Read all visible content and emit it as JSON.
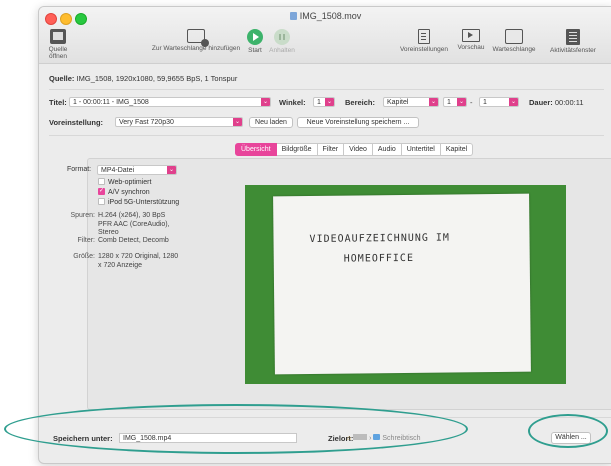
{
  "window": {
    "title": "IMG_1508.mov"
  },
  "toolbar": {
    "open_source": "Quelle öffnen",
    "add_queue": "Zur Warteschlange hinzufügen",
    "start": "Start",
    "pause": "Anhalten",
    "presets": "Voreinstellungen",
    "preview": "Vorschau",
    "queue": "Warteschlange",
    "activity": "Aktivitätsfenster"
  },
  "source": {
    "label": "Quelle:",
    "value": "IMG_1508, 1920x1080, 59,9655 BpS, 1 Tonspur"
  },
  "title_row": {
    "title_label": "Titel:",
    "title_value": "1 - 00:00:11 - IMG_1508",
    "angle_label": "Winkel:",
    "angle_value": "1",
    "range_label": "Bereich:",
    "range_mode": "Kapitel",
    "range_start": "1",
    "range_sep": "-",
    "range_end": "1",
    "duration_label": "Dauer:",
    "duration_value": "00:00:11"
  },
  "preset_row": {
    "label": "Voreinstellung:",
    "value": "Very Fast 720p30",
    "reload": "Neu laden",
    "save_new": "Neue Voreinstellung speichern ..."
  },
  "tabs": [
    "Übersicht",
    "Bildgröße",
    "Filter",
    "Video",
    "Audio",
    "Untertitel",
    "Kapitel"
  ],
  "summary": {
    "format_label": "Format:",
    "format_value": "MP4-Datei",
    "web_optimized": "Web-optimiert",
    "av_sync": "A/V synchron",
    "ipod": "iPod 5G-Unterstützung",
    "tracks_label": "Spuren:",
    "tracks_value": "H.264 (x264), 30 BpS PFR AAC (CoreAudio), Stereo",
    "filter_label": "Filter:",
    "filter_value": "Comb Detect, Decomb",
    "size_label": "Größe:",
    "size_value": "1280 x 720 Original, 1280 x 720 Anzeige"
  },
  "preview_text": {
    "line1": "VIDEOAUFZEICHNUNG IM",
    "line2": "HOMEOFFICE"
  },
  "save_row": {
    "save_label": "Speichern unter:",
    "save_value": "IMG_1508.mp4",
    "dest_label": "Zielort:",
    "dest_folder": "Schreibtisch",
    "choose": "Wählen ..."
  },
  "colors": {
    "accent": "#e8459b",
    "start_green": "#3db36b",
    "highlight_oval": "#2f9e8f"
  }
}
